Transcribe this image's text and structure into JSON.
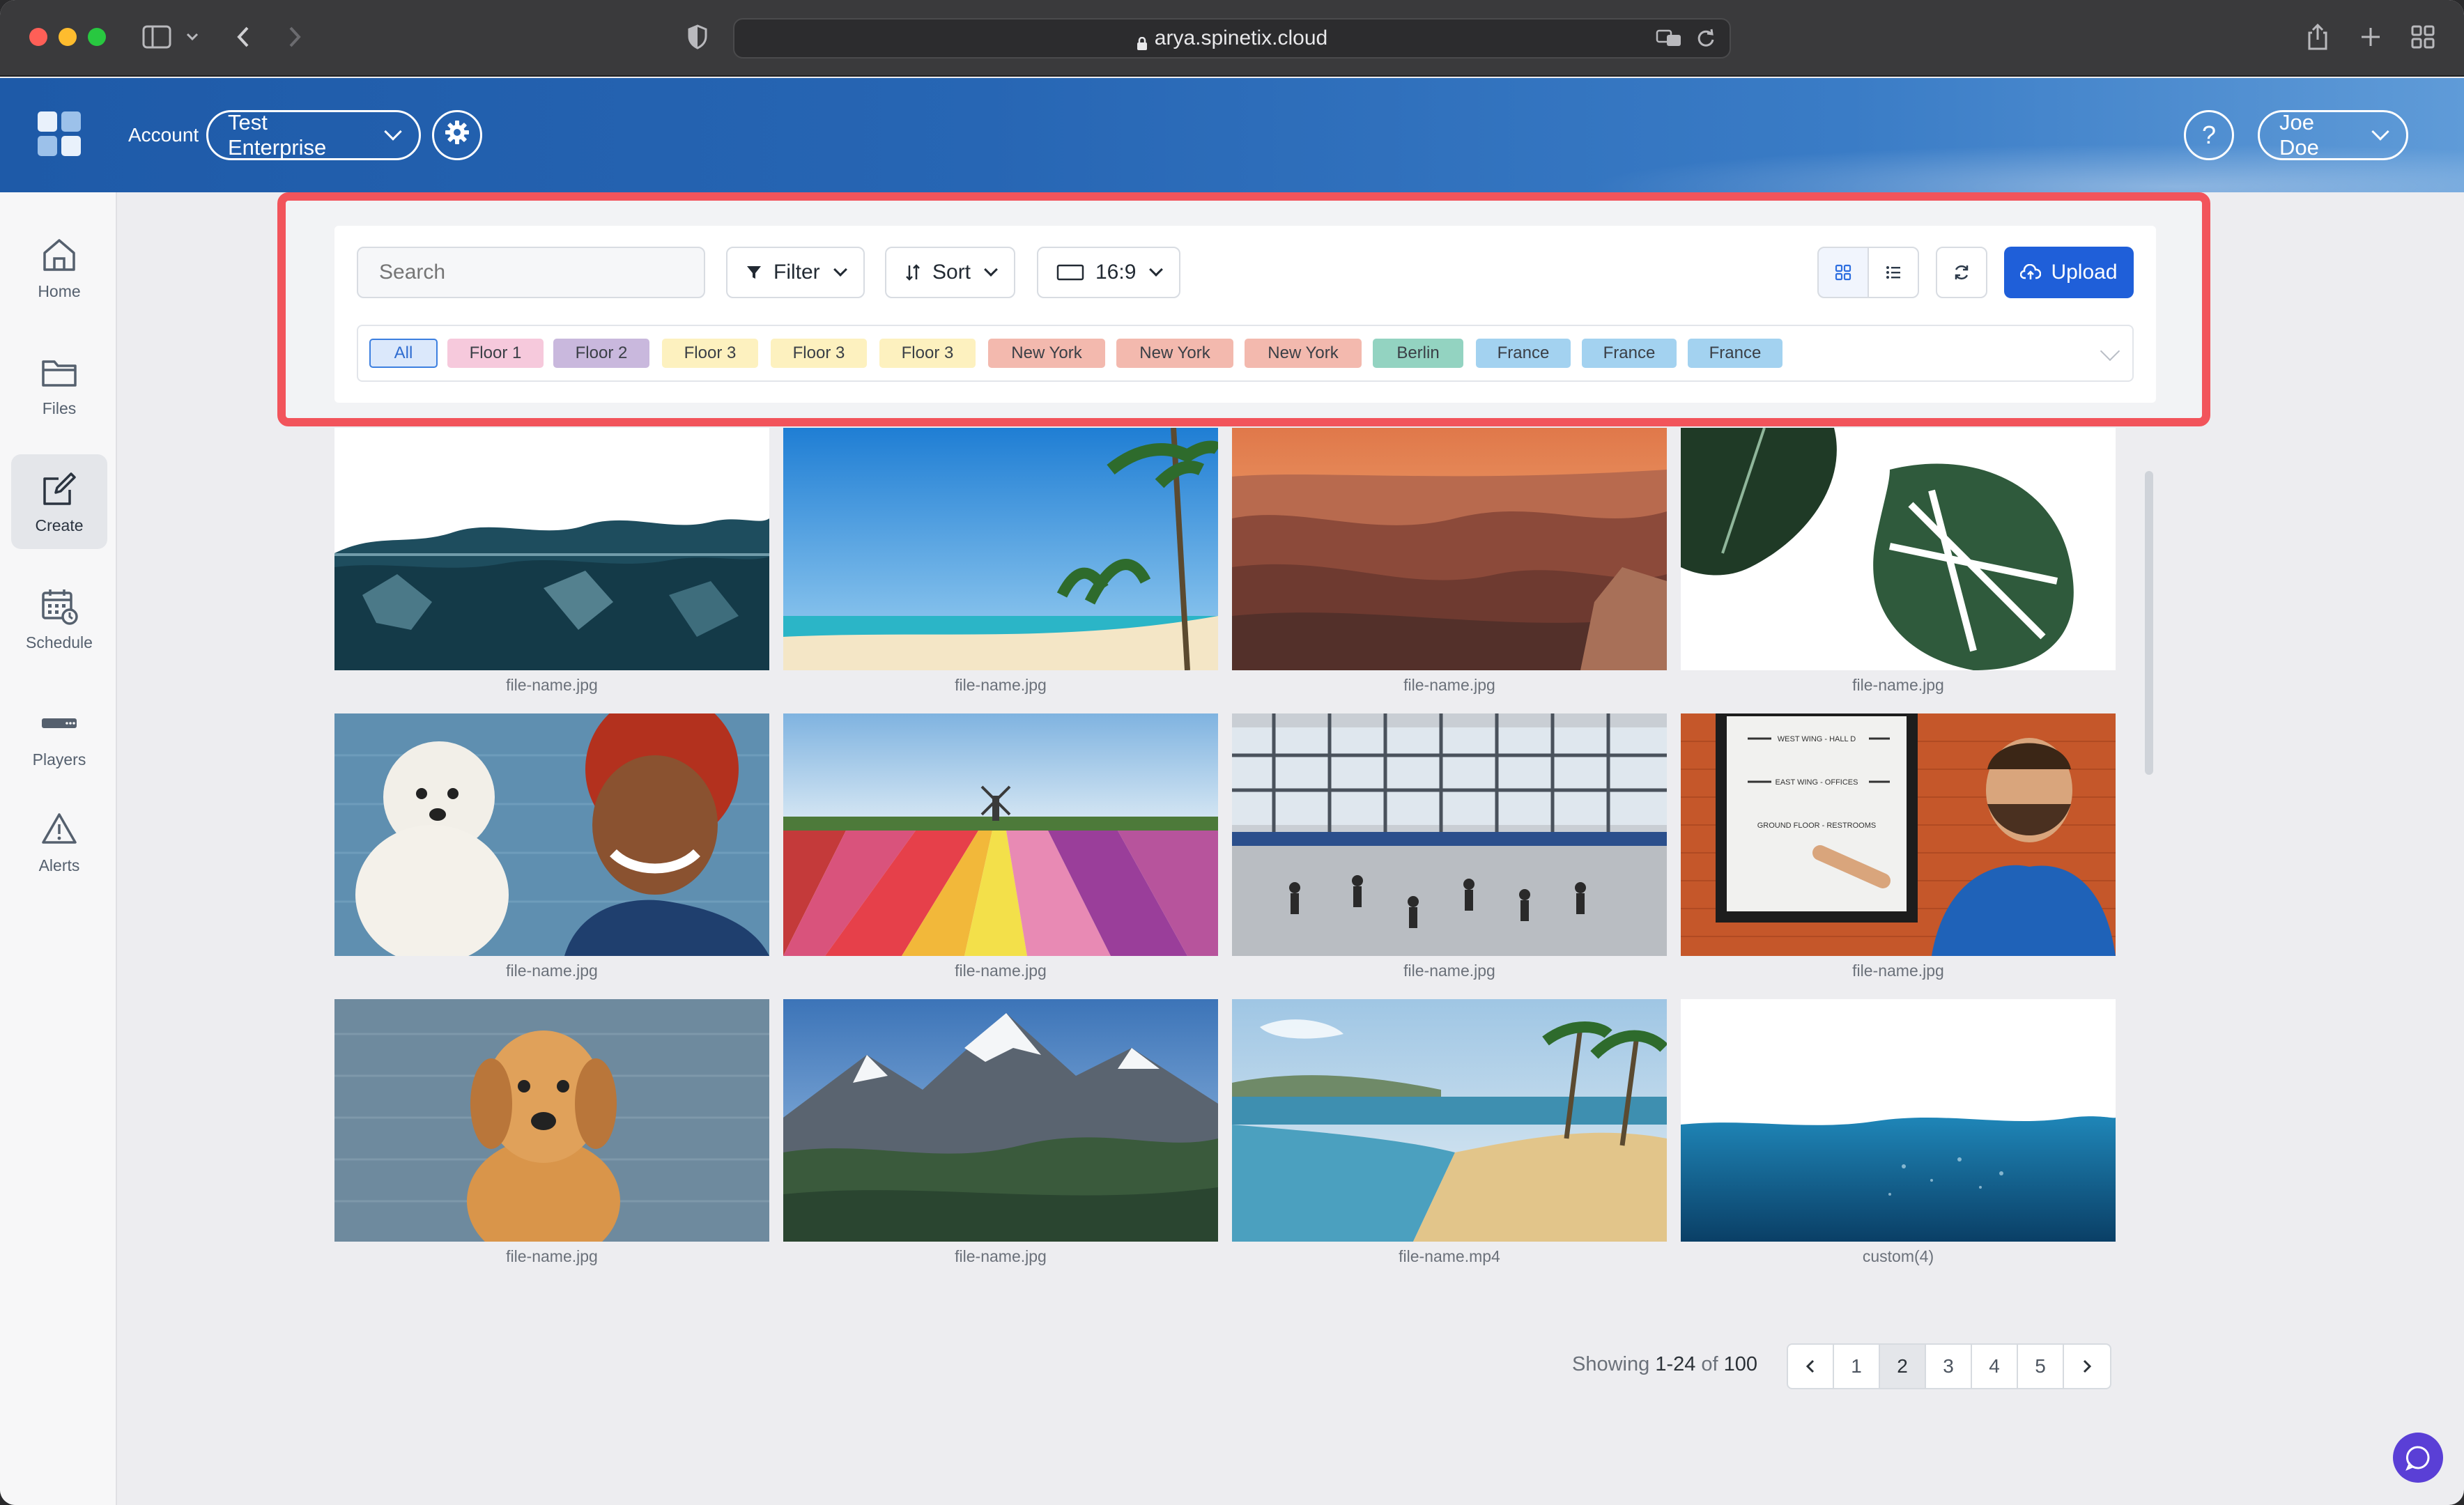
{
  "browser": {
    "url": "arya.spinetix.cloud"
  },
  "header": {
    "account_label": "Account",
    "account_value": "Test Enterprise",
    "help_label": "?",
    "user_name": "Joe Doe"
  },
  "sidebar": {
    "items": [
      {
        "label": "Home",
        "icon": "home-icon",
        "active": false
      },
      {
        "label": "Files",
        "icon": "folder-icon",
        "active": false
      },
      {
        "label": "Create",
        "icon": "edit-icon",
        "active": true
      },
      {
        "label": "Schedule",
        "icon": "calendar-icon",
        "active": false
      },
      {
        "label": "Players",
        "icon": "player-icon",
        "active": false
      },
      {
        "label": "Alerts",
        "icon": "alert-icon",
        "active": false
      }
    ]
  },
  "toolbar": {
    "search_placeholder": "Search",
    "filter_label": "Filter",
    "sort_label": "Sort",
    "ratio_label": "16:9",
    "upload_label": "Upload"
  },
  "tags": [
    {
      "label": "All",
      "color": "#dbe8fb"
    },
    {
      "label": "Floor 1",
      "color": "#f6c9dc"
    },
    {
      "label": "Floor 2",
      "color": "#c9b8dd"
    },
    {
      "label": "Floor 3",
      "color": "#fdf1bf"
    },
    {
      "label": "Floor 3",
      "color": "#fdf1bf"
    },
    {
      "label": "Floor 3",
      "color": "#fdf1bf"
    },
    {
      "label": "New York",
      "color": "#f3b9ae"
    },
    {
      "label": "New York",
      "color": "#f3b9ae"
    },
    {
      "label": "New York",
      "color": "#f3b9ae"
    },
    {
      "label": "Berlin",
      "color": "#93d3c1"
    },
    {
      "label": "France",
      "color": "#a3d2f0"
    },
    {
      "label": "France",
      "color": "#a3d2f0"
    },
    {
      "label": "France",
      "color": "#a3d2f0"
    }
  ],
  "files": [
    {
      "name": "file-name.jpg",
      "subject": "ice-water"
    },
    {
      "name": "file-name.jpg",
      "subject": "palm-beach"
    },
    {
      "name": "file-name.jpg",
      "subject": "canyon"
    },
    {
      "name": "file-name.jpg",
      "subject": "monstera-leaves"
    },
    {
      "name": "file-name.jpg",
      "subject": "woman-with-dog"
    },
    {
      "name": "file-name.jpg",
      "subject": "tulip-field"
    },
    {
      "name": "file-name.jpg",
      "subject": "airport-terminal"
    },
    {
      "name": "file-name.jpg",
      "subject": "man-pointing-sign"
    },
    {
      "name": "file-name.jpg",
      "subject": "golden-retriever"
    },
    {
      "name": "file-name.jpg",
      "subject": "snowy-mountains"
    },
    {
      "name": "file-name.mp4",
      "subject": "tropical-beach"
    },
    {
      "name": "custom(4)",
      "subject": "underwater-wave"
    }
  ],
  "sign_text": {
    "line1": "WEST WING - HALL D",
    "line2": "EAST WING - OFFICES",
    "line3": "GROUND FLOOR - RESTROOMS"
  },
  "pagination": {
    "showing_prefix": "Showing ",
    "range": "1-24",
    "of_word": " of ",
    "total": "100",
    "pages": [
      "1",
      "2",
      "3",
      "4",
      "5"
    ],
    "current_page": "2"
  },
  "colors": {
    "accent": "#1f5fd9",
    "highlight": "#f2545b",
    "header_gradient_start": "#1e5aa8",
    "chat_bubble": "#5a3fd6"
  }
}
